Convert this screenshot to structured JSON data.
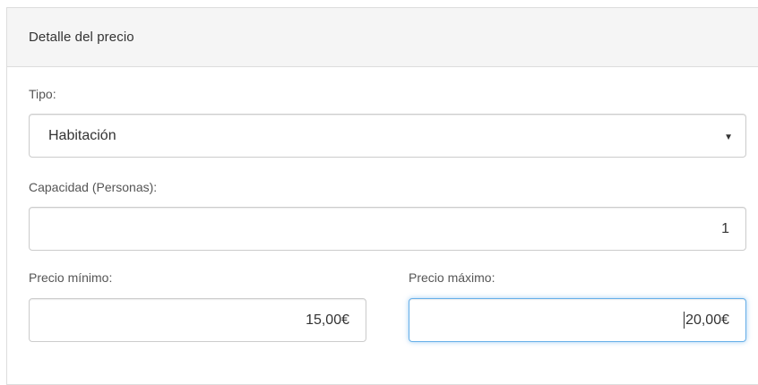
{
  "panel": {
    "title": "Detalle del precio"
  },
  "form": {
    "tipo": {
      "label": "Tipo:",
      "value": "Habitación"
    },
    "capacidad": {
      "label": "Capacidad (Personas):",
      "value": "1"
    },
    "precio_minimo": {
      "label": "Precio mínimo:",
      "value": "15,00€"
    },
    "precio_maximo": {
      "label": "Precio máximo:",
      "value": "20,00€"
    }
  },
  "icons": {
    "select_caret": "caret-down-icon"
  }
}
